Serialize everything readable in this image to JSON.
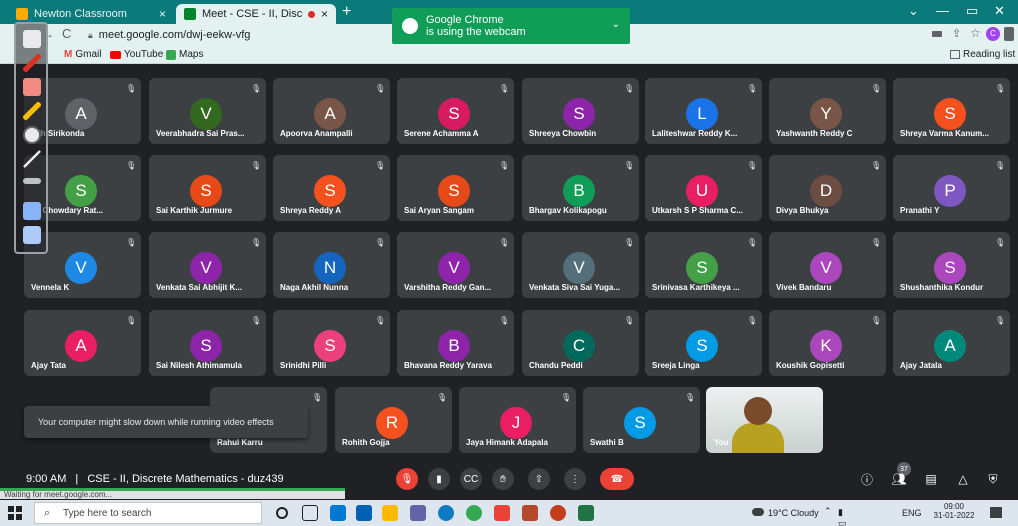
{
  "browser": {
    "tabs": [
      {
        "label": "Newton Classroom",
        "active": false
      },
      {
        "label": "Meet - CSE - II, Discrete Mat",
        "active": true,
        "recording": true
      }
    ],
    "url": "meet.google.com/dwj-eekw-vfg",
    "bookmarks": [
      "Gmail",
      "YouTube",
      "Maps"
    ],
    "reading_list": "Reading list",
    "webcam_notice": {
      "line1": "Google Chrome",
      "line2": "is using the webcam"
    },
    "status": "Waiting for meet.google.com..."
  },
  "annotation_tools": [
    "pointer-tool",
    "pen-tool",
    "eraser-tool",
    "highlighter-tool",
    "cursor-tool",
    "line-tool",
    "rectangle-tool",
    "screen-tool",
    "whiteboard-tool"
  ],
  "participants_rows": [
    [
      {
        "initial": "A",
        "name": "udh Sirikonda",
        "color": "#5f6368"
      },
      {
        "initial": "V",
        "name": "Veerabhadra Sai Pras...",
        "color": "#33691e"
      },
      {
        "initial": "A",
        "name": "Apoorva Anampalli",
        "color": "#795548"
      },
      {
        "initial": "S",
        "name": "Serene Achamma A",
        "color": "#d81b60"
      },
      {
        "initial": "S",
        "name": "Shreeya Chowbin",
        "color": "#8e24aa"
      },
      {
        "initial": "L",
        "name": "Laliteshwar Reddy K...",
        "color": "#1a73e8"
      },
      {
        "initial": "Y",
        "name": "Yashwanth Reddy C",
        "color": "#795548"
      },
      {
        "initial": "S",
        "name": "Shreya Varma Kanum...",
        "color": "#f4511e"
      }
    ],
    [
      {
        "initial": "S",
        "name": "na Chowdary Rat...",
        "color": "#43a047"
      },
      {
        "initial": "S",
        "name": "Sai Karthik Jurmure",
        "color": "#e64a19"
      },
      {
        "initial": "S",
        "name": "Shreya Reddy A",
        "color": "#f4511e"
      },
      {
        "initial": "S",
        "name": "Sai Aryan Sangam",
        "color": "#e64a19"
      },
      {
        "initial": "B",
        "name": "Bhargav Kolikapogu",
        "color": "#0f9d58"
      },
      {
        "initial": "U",
        "name": "Utkarsh S P Sharma C...",
        "color": "#e91e63"
      },
      {
        "initial": "D",
        "name": "Divya Bhukya",
        "color": "#6d4c41"
      },
      {
        "initial": "P",
        "name": "Pranathi Y",
        "color": "#7e57c2"
      }
    ],
    [
      {
        "initial": "V",
        "name": "Vennela K",
        "color": "#1e88e5"
      },
      {
        "initial": "V",
        "name": "Venkata Sai Abhijit K...",
        "color": "#8e24aa"
      },
      {
        "initial": "N",
        "name": "Naga Akhil Nunna",
        "color": "#1565c0"
      },
      {
        "initial": "V",
        "name": "Varshitha Reddy Gan...",
        "color": "#8e24aa"
      },
      {
        "initial": "V",
        "name": "Venkata Siva Sai Yuga...",
        "color": "#546e7a"
      },
      {
        "initial": "S",
        "name": "Srinivasa Karthikeya ...",
        "color": "#43a047"
      },
      {
        "initial": "V",
        "name": "Vivek Bandaru",
        "color": "#ab47bc"
      },
      {
        "initial": "S",
        "name": "Shushanthika Kondur",
        "color": "#ab47bc"
      }
    ],
    [
      {
        "initial": "A",
        "name": "Ajay Tata",
        "color": "#e91e63"
      },
      {
        "initial": "S",
        "name": "Sai Nilesh Athimamula",
        "color": "#8e24aa"
      },
      {
        "initial": "S",
        "name": "Srinidhi Pilli",
        "color": "#ec407a"
      },
      {
        "initial": "B",
        "name": "Bhavana Reddy Yarava",
        "color": "#8e24aa"
      },
      {
        "initial": "C",
        "name": "Chandu Peddi",
        "color": "#00695c"
      },
      {
        "initial": "S",
        "name": "Sreeja Linga",
        "color": "#039be5"
      },
      {
        "initial": "K",
        "name": "Koushik Gopisetti",
        "color": "#ab47bc"
      },
      {
        "initial": "A",
        "name": "Ajay Jatala",
        "color": "#00897b"
      }
    ],
    [
      {
        "initial": "",
        "name": "Rahul Karru",
        "color": "#3c4043"
      },
      {
        "initial": "R",
        "name": "Rohith Gojja",
        "color": "#f4511e"
      },
      {
        "initial": "J",
        "name": "Jaya Himank Adapala",
        "color": "#e91e63"
      },
      {
        "initial": "S",
        "name": "Swathi B",
        "color": "#039be5"
      }
    ]
  ],
  "self_tile_label": "You",
  "toast": "Your computer might slow down while running video effects",
  "meeting": {
    "time": "9:00 AM",
    "separator": "|",
    "title": "CSE - II, Discrete Mathematics - duz439",
    "participant_count": "37"
  },
  "taskbar": {
    "search_placeholder": "Type here to search",
    "weather": "19°C  Cloudy",
    "lang": "ENG",
    "clock_time": "09:00",
    "clock_date": "31-01-2022"
  }
}
